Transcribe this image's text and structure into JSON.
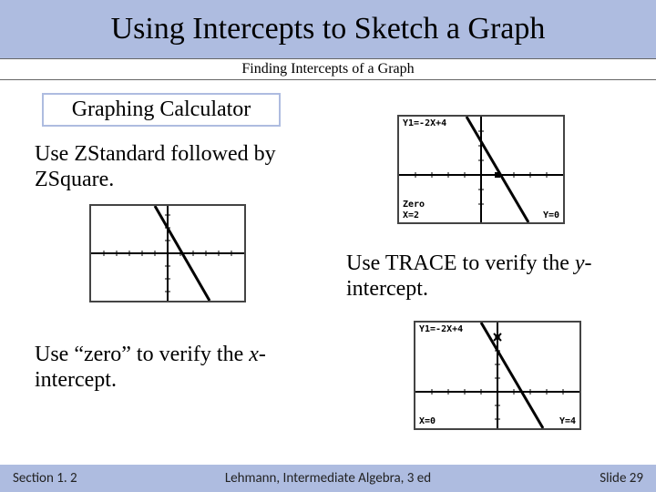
{
  "title": "Using Intercepts to Sketch a Graph",
  "subtitle": "Finding Intercepts of a Graph",
  "section_label": "Graphing Calculator",
  "txt": {
    "zstandard": "Use ZStandard followed by ZSquare.",
    "trace_pre": "Use TRACE to verify the ",
    "trace_var": "y",
    "trace_post": "-intercept.",
    "zero_pre": "Use “zero” to verify the ",
    "zero_var": "x",
    "zero_post": "-intercept."
  },
  "calc2": {
    "title": "Y1=-2X+4",
    "bl_lab": "Zero",
    "bl": "X=2",
    "br": "Y=0"
  },
  "calc3": {
    "title": "Y1=-2X+4",
    "bl": "X=0",
    "br": "Y=4"
  },
  "footer": {
    "left": "Section 1. 2",
    "mid": "Lehmann, Intermediate Algebra, 3 ed",
    "right": "Slide 29"
  },
  "chart_data": [
    {
      "type": "line",
      "title": "",
      "xlabel": "",
      "ylabel": "",
      "xlim": [
        -10,
        10
      ],
      "ylim": [
        -6,
        6
      ],
      "series": [
        {
          "name": "Y1=-2X+4",
          "x": [
            -1,
            5
          ],
          "y": [
            6,
            -6
          ]
        }
      ],
      "annotations": []
    },
    {
      "type": "line",
      "title": "Y1=-2X+4",
      "xlabel": "",
      "ylabel": "",
      "xlim": [
        -10,
        10
      ],
      "ylim": [
        -6,
        6
      ],
      "series": [
        {
          "name": "Y1=-2X+4",
          "x": [
            -1,
            5
          ],
          "y": [
            6,
            -6
          ]
        }
      ],
      "annotations": [
        {
          "label": "Zero",
          "x": 2,
          "y": 0
        },
        {
          "label": "X=2",
          "x": 2,
          "y": 0
        },
        {
          "label": "Y=0",
          "x": 2,
          "y": 0
        }
      ]
    },
    {
      "type": "line",
      "title": "Y1=-2X+4",
      "xlabel": "",
      "ylabel": "",
      "xlim": [
        -10,
        10
      ],
      "ylim": [
        -6,
        6
      ],
      "series": [
        {
          "name": "Y1=-2X+4",
          "x": [
            -1,
            5
          ],
          "y": [
            6,
            -6
          ]
        }
      ],
      "annotations": [
        {
          "label": "X=0",
          "x": 0,
          "y": 4
        },
        {
          "label": "Y=4",
          "x": 0,
          "y": 4
        }
      ]
    }
  ]
}
